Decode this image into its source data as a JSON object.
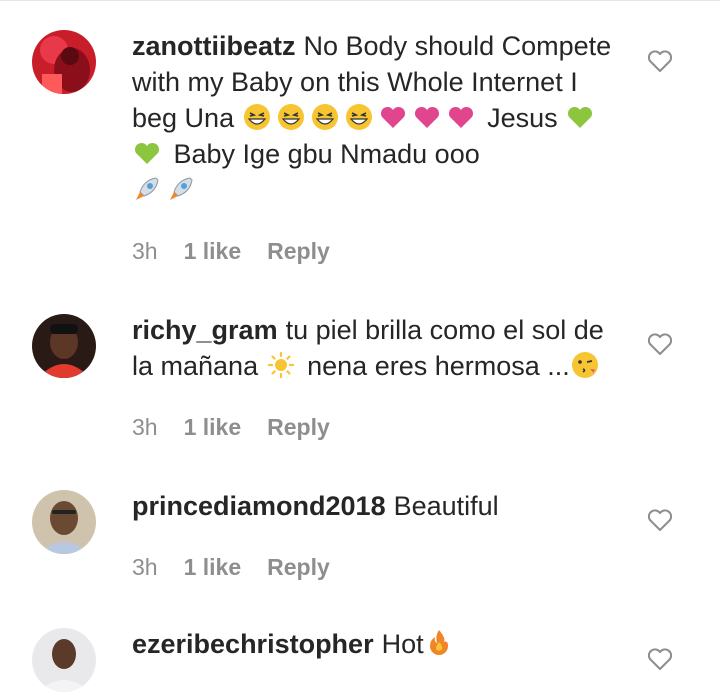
{
  "comments": [
    {
      "username": "zanottiibeatz",
      "text_part1": "No Body should Compete with my Baby on this Whole Internet I beg Una",
      "emojis_1": [
        "grinning-squint-emoji",
        "grinning-squint-emoji",
        "grinning-squint-emoji",
        "grinning-squint-emoji",
        "pink-heart-emoji",
        "pink-heart-emoji",
        "pink-heart-emoji"
      ],
      "text_part2": "Jesus",
      "emojis_2": [
        "green-heart-emoji",
        "green-heart-emoji"
      ],
      "text_part3": "Baby Ige gbu Nmadu ooo",
      "emojis_3": [
        "rocket-emoji",
        "rocket-emoji"
      ],
      "time": "3h",
      "likes": "1 like",
      "reply": "Reply"
    },
    {
      "username": "richy_gram",
      "text_part1": "tu piel brilla como el sol de la mañana",
      "emojis_1": [
        "sun-emoji"
      ],
      "text_part2": "nena eres hermosa ...",
      "emojis_2": [
        "kissing-wink-emoji"
      ],
      "time": "3h",
      "likes": "1 like",
      "reply": "Reply"
    },
    {
      "username": "princediamond2018",
      "text_part1": "Beautiful",
      "time": "3h",
      "likes": "1 like",
      "reply": "Reply"
    },
    {
      "username": "ezeribechristopher",
      "text_part1": "Hot",
      "emojis_1": [
        "fire-emoji"
      ]
    }
  ],
  "colors": {
    "text": "#262626",
    "meta": "#8e8e8e",
    "pink_heart": "#e0458e",
    "green_heart": "#8cc63f"
  }
}
